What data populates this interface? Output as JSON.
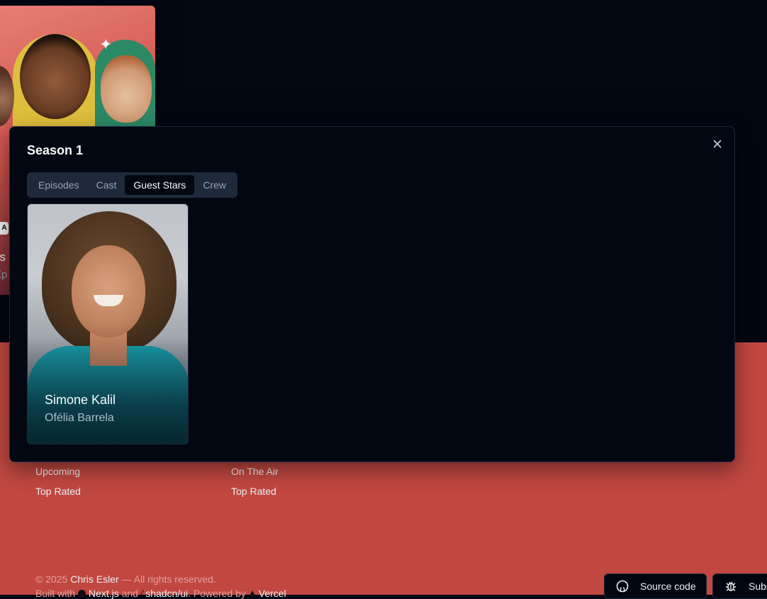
{
  "background": {
    "poster": {
      "title_fragment": "as",
      "subtitle_fragment": "Ep",
      "badge_fragment": "A"
    },
    "footer": {
      "links_col1": [
        "Upcoming",
        "Top Rated"
      ],
      "links_col2": [
        "On The Air",
        "Top Rated"
      ],
      "copyright_prefix": "© 2025",
      "copyright_name": "Chris Esler",
      "copyright_suffix": "— All rights reserved.",
      "built_with_label": "Built with",
      "nextjs_label": "Next.js",
      "and_label": "and",
      "shadcn_label": "shadcn/ui",
      "powered_by_label": ". Powered by",
      "vercel_label": "Vercel",
      "source_code_label": "Source code",
      "submit_label": "Subm"
    }
  },
  "dialog": {
    "title": "Season 1",
    "tabs": [
      {
        "label": "Episodes",
        "active": false
      },
      {
        "label": "Cast",
        "active": false
      },
      {
        "label": "Guest Stars",
        "active": true
      },
      {
        "label": "Crew",
        "active": false
      }
    ],
    "guest_stars": [
      {
        "name": "Simone Kalil",
        "character": "Ofélia Barrela"
      }
    ]
  },
  "colors": {
    "page_bg": "#030712",
    "footer_bg": "#c94a44",
    "tab_active_bg": "#030712",
    "tabs_bg": "#1e293b"
  }
}
